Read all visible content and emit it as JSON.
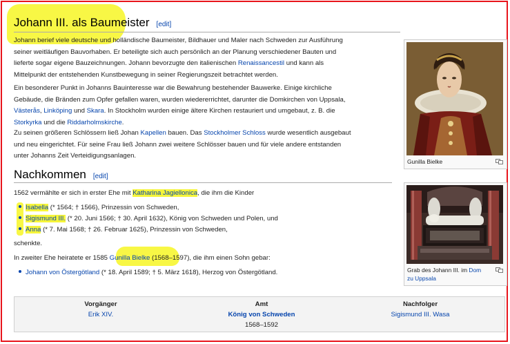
{
  "section1": {
    "heading": "Johann III. als Baumeister",
    "edit": "[edit]",
    "p1": {
      "a": "Johann berief viele deutsche und holländische Baumeister, Bildhauer und Maler nach Schweden zur Ausführung",
      "b": "seiner weitläufigen Bauvorhaben. Er beteiligte sich auch persönlich an der Planung verschiedener Bauten und",
      "c1": "lieferte sogar eigene Bauzeichnungen. Johann bevorzugte den italienischen ",
      "c_link": "Renaissancestil",
      "c2": " und kann als",
      "d": "Mittelpunkt der entstehenden Kunstbewegung in seiner Regierungszeit betrachtet werden."
    },
    "p2": {
      "a": "Ein besonderer Punkt in Johanns Bauinteresse war die Bewahrung bestehender Bauwerke. Einige kirchliche",
      "b": "Gebäude, die Bränden zum Opfer gefallen waren, wurden wiedererrichtet, darunter die Domkirchen von Uppsala,",
      "c_l1": "Västerås",
      "c_s1": ", ",
      "c_l2": "Linköping",
      "c_s2": " und ",
      "c_l3": "Skara",
      "c_s3": ". In Stockholm wurden einige ältere Kirchen restauriert und umgebaut, z. B. die",
      "d_l1": "Storkyrka",
      "d_s1": " und die ",
      "d_l2": "Riddarholmskirche",
      "d_s2": "."
    },
    "p3": {
      "a1": "Zu seinen größeren Schlössern ließ Johan ",
      "a_l1": "Kapellen",
      "a2": " bauen. Das ",
      "a_l2": "Stockholmer Schloss",
      "a3": " wurde wesentlich ausgebaut",
      "b": "und neu eingerichtet. Für seine Frau ließ Johann zwei weitere Schlösser bauen und für viele andere entstanden",
      "c": "unter Johanns Zeit Verteidigungsanlagen."
    }
  },
  "section2": {
    "heading": "Nachkommen",
    "edit": "[edit]",
    "intro1": "1562 vermählte er sich in erster Ehe mit ",
    "intro_link": "Katharina Jagiellonica",
    "intro2": ", die ihm die Kinder",
    "children": [
      {
        "name": "Isabella",
        "text": " (* 1564; † 1566), Prinzessin von Schweden,"
      },
      {
        "name": "Sigismund III.",
        "text": " (* 20. Juni 1566; † 30. April 1632), König von Schweden und Polen, und"
      },
      {
        "name": "Anna",
        "text": " (* 7. Mai 1568; † 26. Februar 1625), Prinzessin von Schweden,"
      }
    ],
    "schenkte": "schenkte.",
    "second1": "In zweiter Ehe heiratete er 1585 ",
    "second_link": "Gunilla Bielke",
    "second2": " (1568–1597), die ihm einen Sohn gebar:",
    "son_name": "Johann von Östergötland",
    "son_text": " (* 18. April 1589; † 5. März 1618), Herzog von Östergötland."
  },
  "thumbs": {
    "portrait_caption": "Gunilla Bielke",
    "tomb_caption_text": "Grab des Johann III. im ",
    "tomb_caption_link1": "Dom",
    "tomb_caption_link2": "zu Uppsala"
  },
  "succession": {
    "pred_label": "Vorgänger",
    "pred_value": "Erik XIV.",
    "office_label": "Amt",
    "office_value": "König von Schweden",
    "office_years": "1568–1592",
    "succ_label": "Nachfolger",
    "succ_value": "Sigismund III. Wasa"
  },
  "colors": {
    "link": "#0645ad",
    "highlight": "#f6f53a",
    "frame": "#e8141b"
  }
}
